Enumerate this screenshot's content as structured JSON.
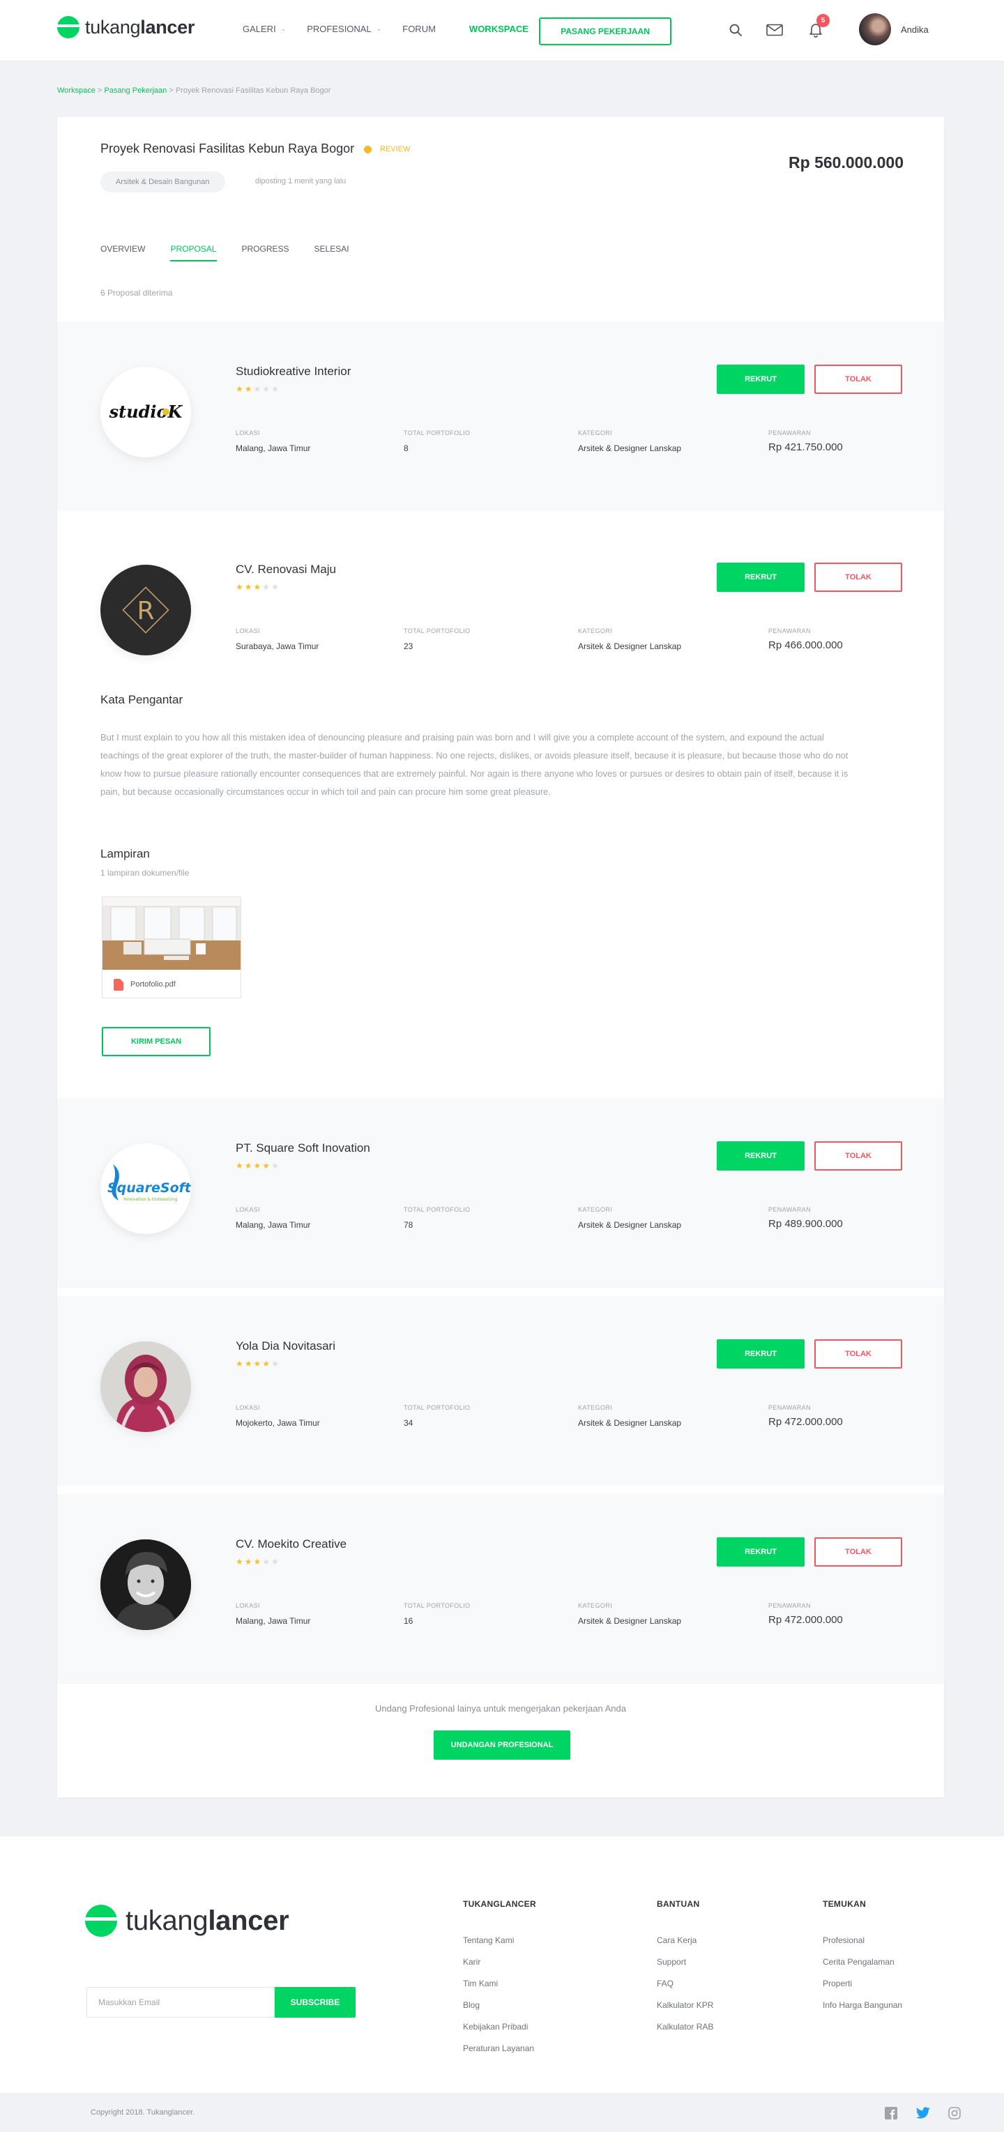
{
  "header": {
    "logo_light": "tukang",
    "logo_bold": "lancer",
    "nav": [
      {
        "label": "GALERI"
      },
      {
        "label": "PROFESIONAL"
      },
      {
        "label": "FORUM"
      },
      {
        "label": "WORKSPACE"
      }
    ],
    "post_button": "PASANG PEKERJAAN",
    "notification_count": "5",
    "user_name": "Andika",
    "icons": [
      "search-icon",
      "mail-icon",
      "bell-icon"
    ]
  },
  "breadcrumb": {
    "items": [
      "Workspace",
      "Pasang Pekerjaan"
    ],
    "separator": ">",
    "current": "Proyek Renovasi Fasilitas Kebun Raya Bogor"
  },
  "project": {
    "title": "Proyek Renovasi Fasilitas Kebun Raya Bogor",
    "status": "REVIEW",
    "category": "Arsitek & Desain Bangunan",
    "posted": "diposting 1 menit yang lalu",
    "price": "Rp 560.000.000",
    "tabs": [
      "OVERVIEW",
      "PROPOSAL",
      "PROGRESS",
      "SELESAI"
    ],
    "active_tab": "PROPOSAL",
    "proposal_count": "6 Proposal diterima"
  },
  "labels": {
    "location": "LOKASI",
    "portfolio": "TOTAL PORTOFOLIO",
    "category": "KATEGORI",
    "offer": "PENAWARAN",
    "recruit": "REKRUT",
    "reject": "TOLAK"
  },
  "proposals": [
    {
      "name": "Studiokreative Interior",
      "rating": 2,
      "location": "Malang, Jawa Timur",
      "portfolio": "8",
      "category": "Arsitek & Designer Lanskap",
      "offer": "Rp 421.750.000",
      "logo": "studiok",
      "logo_text": "studioK"
    },
    {
      "name": "CV. Renovasi Maju",
      "rating": 3,
      "location": "Surabaya, Jawa Timur",
      "portfolio": "23",
      "category": "Arsitek & Designer Lanskap",
      "offer": "Rp 466.000.000",
      "logo": "renovasi",
      "logo_text": "R"
    },
    {
      "name": "PT. Square Soft Inovation",
      "rating": 4,
      "location": "Malang, Jawa Timur",
      "portfolio": "78",
      "category": "Arsitek & Designer Lanskap",
      "offer": "Rp 489.900.000",
      "logo": "squaresoft",
      "logo_text": "SquareSoft",
      "logo_subtext": "Innovation & Outsourcing"
    },
    {
      "name": "Yola Dia Novitasari",
      "rating": 4,
      "location": "Mojokerto, Jawa Timur",
      "portfolio": "34",
      "category": "Arsitek & Designer Lanskap",
      "offer": "Rp 472.000.000",
      "logo": "photo-woman"
    },
    {
      "name": "CV. Moekito Creative",
      "rating": 3,
      "location": "Malang, Jawa Timur",
      "portfolio": "16",
      "category": "Arsitek & Designer Lanskap",
      "offer": "Rp 472.000.000",
      "logo": "photo-man"
    }
  ],
  "expanded": {
    "intro_title": "Kata Pengantar",
    "intro_text": "But I must explain to you how all this mistaken idea of denouncing pleasure and praising pain was born and I will give you a complete account of the system, and expound the actual teachings of the great explorer of the truth, the master-builder of human happiness. No one rejects, dislikes, or avoids pleasure itself, because it is pleasure, but because those who do not know how to pursue pleasure rationally encounter consequences that are extremely painful. Nor again is there anyone who loves or pursues or desires to obtain pain of itself, because it is pain, but because occasionally circumstances occur in which toil and pain can procure him some great pleasure.",
    "attach_title": "Lampiran",
    "attach_sub": "1 lampiran dokumen/file",
    "file_name": "Portofolio.pdf",
    "message_button": "KIRIM PESAN"
  },
  "invite": {
    "text": "Undang Profesional lainya untuk mengerjakan pekerjaan Anda",
    "button": "UNDANGAN PROFESIONAL"
  },
  "footer": {
    "email_placeholder": "Masukkan Email",
    "subscribe": "SUBSCRIBE",
    "columns": [
      {
        "title": "TUKANGLANCER",
        "links": [
          "Tentang Kami",
          "Karir",
          "Tim Kami",
          "Blog",
          "Kebijakan Pribadi",
          "Peraturan Layanan"
        ]
      },
      {
        "title": "BANTUAN",
        "links": [
          "Cara Kerja",
          "Support",
          "FAQ",
          "Kalkulator KPR",
          "Kalkulator RAB"
        ]
      },
      {
        "title": "TEMUKAN",
        "links": [
          "Profesional",
          "Cerita Pengalaman",
          "Properti",
          "Info Harga Bangunan"
        ]
      }
    ],
    "copyright": "Copyright 2018. Tukanglancer.",
    "social": [
      "facebook-icon",
      "twitter-icon",
      "instagram-icon"
    ]
  },
  "colors": {
    "accent": "#00d563",
    "danger": "#f8545d",
    "star": "#f5c12b",
    "status": "#f5b82e"
  }
}
